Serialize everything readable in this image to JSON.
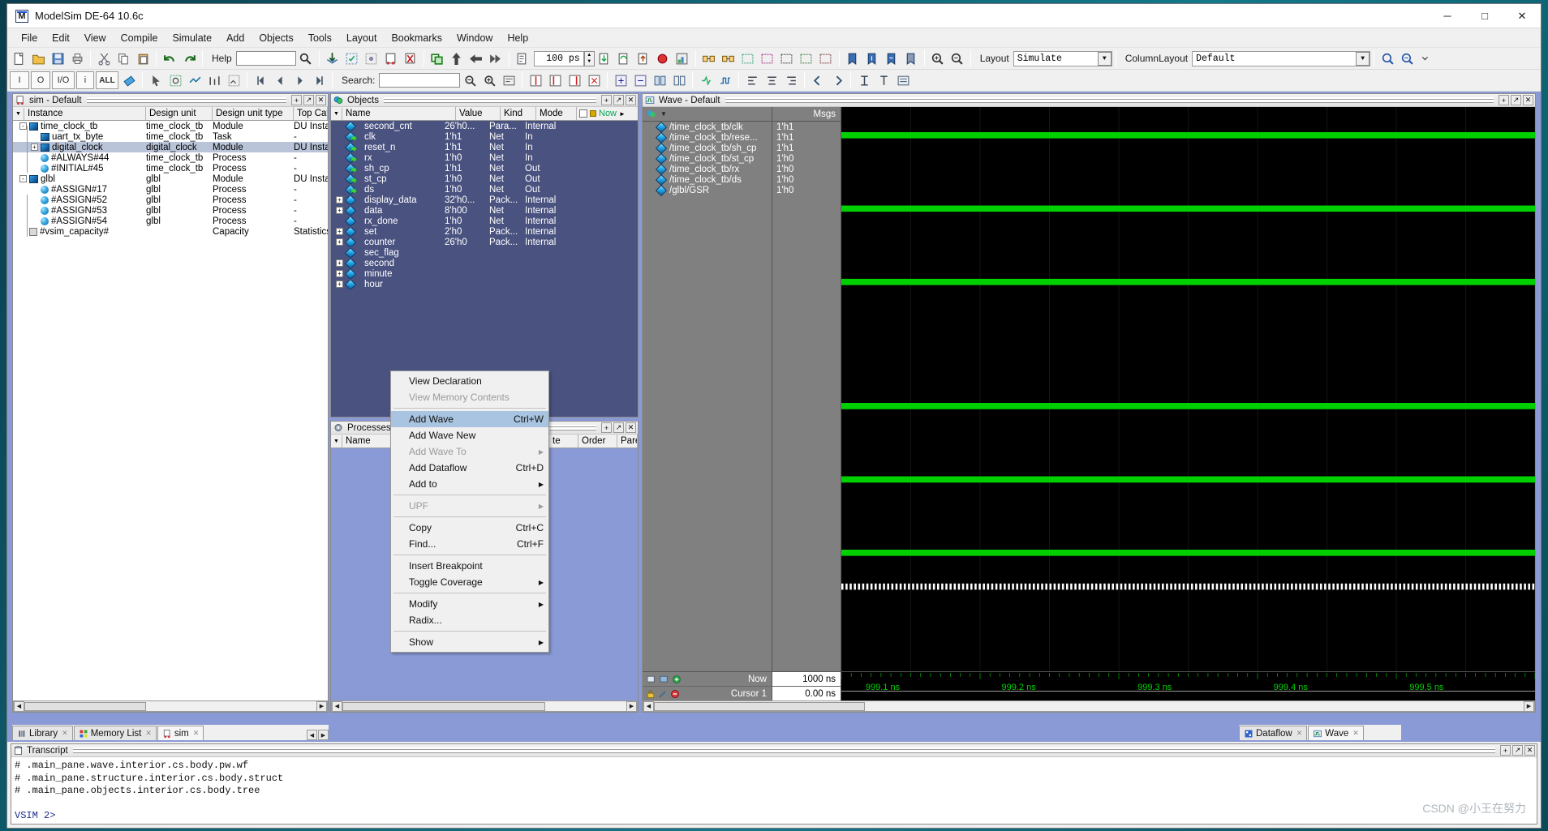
{
  "window": {
    "title": "ModelSim DE-64 10.6c",
    "minimize": "─",
    "maximize": "□",
    "close": "✕"
  },
  "menubar": [
    "File",
    "Edit",
    "View",
    "Compile",
    "Simulate",
    "Add",
    "Objects",
    "Tools",
    "Layout",
    "Bookmarks",
    "Window",
    "Help"
  ],
  "toolbar": {
    "help_label": "Help",
    "help_value": "",
    "time_step": "100 ps",
    "search_label": "Search:",
    "search_value": "",
    "layout_label": "Layout",
    "layout_value": "Simulate",
    "columnlayout_label": "ColumnLayout",
    "columnlayout_value": "Default",
    "radix_buttons": [
      "I",
      "O",
      "I/O",
      "i",
      "ALL"
    ]
  },
  "sim_pane": {
    "title": "sim - Default",
    "columns": [
      "Instance",
      "Design unit",
      "Design unit type",
      "Top Categor"
    ],
    "rows": [
      {
        "indent": 0,
        "expander": "-",
        "icon": "module",
        "instance": "time_clock_tb",
        "unit": "time_clock_tb",
        "type": "Module",
        "top": "DU Instance",
        "selected": false
      },
      {
        "indent": 1,
        "expander": "",
        "icon": "module",
        "instance": "uart_tx_byte",
        "unit": "time_clock_tb",
        "type": "Task",
        "top": "-",
        "selected": false
      },
      {
        "indent": 1,
        "expander": "+",
        "icon": "module",
        "instance": "digital_clock",
        "unit": "digital_clock",
        "type": "Module",
        "top": "DU Instance",
        "selected": true
      },
      {
        "indent": 1,
        "expander": "",
        "icon": "process",
        "instance": "#ALWAYS#44",
        "unit": "time_clock_tb",
        "type": "Process",
        "top": "-",
        "selected": false
      },
      {
        "indent": 1,
        "expander": "",
        "icon": "process",
        "instance": "#INITIAL#45",
        "unit": "time_clock_tb",
        "type": "Process",
        "top": "-",
        "selected": false
      },
      {
        "indent": 0,
        "expander": "-",
        "icon": "module",
        "instance": "glbl",
        "unit": "glbl",
        "type": "Module",
        "top": "DU Instance",
        "selected": false
      },
      {
        "indent": 1,
        "expander": "",
        "icon": "process",
        "instance": "#ASSIGN#17",
        "unit": "glbl",
        "type": "Process",
        "top": "-",
        "selected": false
      },
      {
        "indent": 1,
        "expander": "",
        "icon": "process",
        "instance": "#ASSIGN#52",
        "unit": "glbl",
        "type": "Process",
        "top": "-",
        "selected": false
      },
      {
        "indent": 1,
        "expander": "",
        "icon": "process",
        "instance": "#ASSIGN#53",
        "unit": "glbl",
        "type": "Process",
        "top": "-",
        "selected": false
      },
      {
        "indent": 1,
        "expander": "",
        "icon": "process",
        "instance": "#ASSIGN#54",
        "unit": "glbl",
        "type": "Process",
        "top": "-",
        "selected": false
      },
      {
        "indent": 0,
        "expander": "",
        "icon": "capacity",
        "instance": "#vsim_capacity#",
        "unit": "",
        "type": "Capacity",
        "top": "Statistics",
        "selected": false
      }
    ]
  },
  "objects_pane": {
    "title": "Objects",
    "columns": [
      "Name",
      "Value",
      "Kind",
      "Mode"
    ],
    "now_label": "Now",
    "rows": [
      {
        "expander": "",
        "name": "second_cnt",
        "value": "26'h0...",
        "kind": "Para...",
        "mode": "Internal",
        "port": "none"
      },
      {
        "expander": "",
        "name": "clk",
        "value": "1'h1",
        "kind": "Net",
        "mode": "In",
        "port": "in"
      },
      {
        "expander": "",
        "name": "reset_n",
        "value": "1'h1",
        "kind": "Net",
        "mode": "In",
        "port": "in"
      },
      {
        "expander": "",
        "name": "rx",
        "value": "1'h0",
        "kind": "Net",
        "mode": "In",
        "port": "in"
      },
      {
        "expander": "",
        "name": "sh_cp",
        "value": "1'h1",
        "kind": "Net",
        "mode": "Out",
        "port": "out"
      },
      {
        "expander": "",
        "name": "st_cp",
        "value": "1'h0",
        "kind": "Net",
        "mode": "Out",
        "port": "out"
      },
      {
        "expander": "",
        "name": "ds",
        "value": "1'h0",
        "kind": "Net",
        "mode": "Out",
        "port": "out"
      },
      {
        "expander": "+",
        "name": "display_data",
        "value": "32'h0...",
        "kind": "Pack...",
        "mode": "Internal",
        "port": "none"
      },
      {
        "expander": "+",
        "name": "data",
        "value": "8'h00",
        "kind": "Net",
        "mode": "Internal",
        "port": "none"
      },
      {
        "expander": "",
        "name": "rx_done",
        "value": "1'h0",
        "kind": "Net",
        "mode": "Internal",
        "port": "none"
      },
      {
        "expander": "+",
        "name": "set",
        "value": "2'h0",
        "kind": "Pack...",
        "mode": "Internal",
        "port": "none"
      },
      {
        "expander": "+",
        "name": "counter",
        "value": "26'h0",
        "kind": "Pack...",
        "mode": "Internal",
        "port": "none"
      },
      {
        "expander": "",
        "name": "sec_flag",
        "value": "",
        "kind": "",
        "mode": "",
        "port": "none"
      },
      {
        "expander": "+",
        "name": "second",
        "value": "",
        "kind": "",
        "mode": "",
        "port": "none"
      },
      {
        "expander": "+",
        "name": "minute",
        "value": "",
        "kind": "",
        "mode": "",
        "port": "none"
      },
      {
        "expander": "+",
        "name": "hour",
        "value": "",
        "kind": "",
        "mode": "",
        "port": "none"
      }
    ]
  },
  "processes_pane": {
    "title": "Processes (",
    "columns": [
      "Name",
      "te",
      "Order",
      "Pare"
    ]
  },
  "context_menu": {
    "items": [
      {
        "label": "View Declaration",
        "shortcut": "",
        "submenu": false,
        "disabled": false,
        "selected": false
      },
      {
        "label": "View Memory Contents",
        "shortcut": "",
        "submenu": false,
        "disabled": true,
        "selected": false
      },
      {
        "separator": true
      },
      {
        "label": "Add Wave",
        "shortcut": "Ctrl+W",
        "submenu": false,
        "disabled": false,
        "selected": true
      },
      {
        "label": "Add Wave New",
        "shortcut": "",
        "submenu": false,
        "disabled": false,
        "selected": false
      },
      {
        "label": "Add Wave To",
        "shortcut": "",
        "submenu": true,
        "disabled": true,
        "selected": false
      },
      {
        "label": "Add Dataflow",
        "shortcut": "Ctrl+D",
        "submenu": false,
        "disabled": false,
        "selected": false
      },
      {
        "label": "Add to",
        "shortcut": "",
        "submenu": true,
        "disabled": false,
        "selected": false
      },
      {
        "separator": true
      },
      {
        "label": "UPF",
        "shortcut": "",
        "submenu": true,
        "disabled": true,
        "selected": false
      },
      {
        "separator": true
      },
      {
        "label": "Copy",
        "shortcut": "Ctrl+C",
        "submenu": false,
        "disabled": false,
        "selected": false
      },
      {
        "label": "Find...",
        "shortcut": "Ctrl+F",
        "submenu": false,
        "disabled": false,
        "selected": false
      },
      {
        "separator": true
      },
      {
        "label": "Insert Breakpoint",
        "shortcut": "",
        "submenu": false,
        "disabled": false,
        "selected": false
      },
      {
        "label": "Toggle Coverage",
        "shortcut": "",
        "submenu": true,
        "disabled": false,
        "selected": false
      },
      {
        "separator": true
      },
      {
        "label": "Modify",
        "shortcut": "",
        "submenu": true,
        "disabled": false,
        "selected": false
      },
      {
        "label": "Radix...",
        "shortcut": "",
        "submenu": false,
        "disabled": false,
        "selected": false
      },
      {
        "separator": true
      },
      {
        "label": "Show",
        "shortcut": "",
        "submenu": true,
        "disabled": false,
        "selected": false
      }
    ]
  },
  "wave_pane": {
    "title": "Wave - Default",
    "msgs_header": "Msgs",
    "signals": [
      {
        "name": "/time_clock_tb/clk",
        "value": "1'h1",
        "level": "high"
      },
      {
        "name": "/time_clock_tb/rese...",
        "value": "1'h1",
        "level": "high"
      },
      {
        "name": "/time_clock_tb/sh_cp",
        "value": "1'h1",
        "level": "high"
      },
      {
        "name": "/time_clock_tb/st_cp",
        "value": "1'h0",
        "level": "low"
      },
      {
        "name": "/time_clock_tb/rx",
        "value": "1'h0",
        "level": "low"
      },
      {
        "name": "/time_clock_tb/ds",
        "value": "1'h0",
        "level": "low"
      },
      {
        "name": "/glbl/GSR",
        "value": "1'h0",
        "level": "dashed"
      }
    ],
    "now_label": "Now",
    "now_value": "1000 ns",
    "cursor_label": "Cursor 1",
    "cursor_value": "0.00 ns",
    "time_ticks": [
      "999.1 ns",
      "999.2 ns",
      "999.3 ns",
      "999.4 ns",
      "999.5 ns"
    ]
  },
  "transcript": {
    "title": "Transcript",
    "lines": [
      "# .main_pane.wave.interior.cs.body.pw.wf",
      "# .main_pane.structure.interior.cs.body.struct",
      "# .main_pane.objects.interior.cs.body.tree",
      "",
      "VSIM 2>"
    ]
  },
  "bottom_tabs_left": [
    {
      "label": "Library",
      "active": false
    },
    {
      "label": "Memory List",
      "active": false
    },
    {
      "label": "sim",
      "active": true
    }
  ],
  "bottom_tabs_right": [
    {
      "label": "Dataflow",
      "active": false
    },
    {
      "label": "Wave",
      "active": true
    }
  ],
  "watermark": "CSDN @小王在努力",
  "colors": {
    "wave_bg": "#000000",
    "wave_green": "#00d000",
    "objects_bg": "#4a5280",
    "selection": "#a8c4e0",
    "accent": "#1b4fd8"
  }
}
